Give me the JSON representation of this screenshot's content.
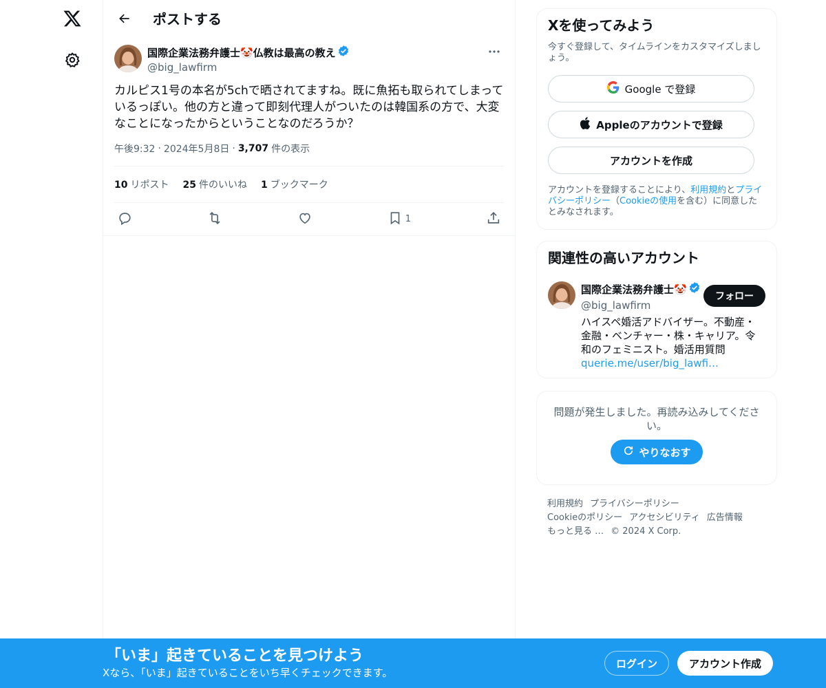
{
  "header": {
    "title": "ポストする"
  },
  "post": {
    "author_name": "国際企業法務弁護士🤡仏教は最高の教え",
    "author_handle": "@big_lawfirm",
    "text": "カルピス1号の本名が5chで晒されてますね。既に魚拓も取られてしまっているっぽい。他の方と違って即刻代理人がついたのは韓国系の方で、大変なことになったからということなのだろうか？",
    "time": "午後9:32",
    "date": "2024年5月8日",
    "views_count": "3,707",
    "views_label": "件の表示",
    "sep": "·",
    "stats": [
      {
        "count": "10",
        "label": "リポスト"
      },
      {
        "count": "25",
        "label": "件のいいね"
      },
      {
        "count": "1",
        "label": "ブックマーク"
      }
    ],
    "actions": {
      "reply": "",
      "repost": "",
      "like": "",
      "bookmark": "1",
      "share": ""
    }
  },
  "signup_card": {
    "title": "Xを使ってみよう",
    "subtitle": "今すぐ登録して、タイムラインをカスタマイズしましょう。",
    "google_label": "Google で登録",
    "apple_label": "Appleのアカウントで登録",
    "create_label": "アカウントを作成",
    "legal_1": "アカウントを登録することにより、",
    "legal_terms": "利用規約",
    "legal_and": "と",
    "legal_privacy": "プライバシーポリシー",
    "legal_2": "（",
    "legal_cookie": "Cookieの使用",
    "legal_3": "を含む）に同意したとみなされます。"
  },
  "related": {
    "title": "関連性の高いアカウント",
    "account": {
      "name": "国際企業法務弁護士🤡",
      "handle": "@big_lawfirm",
      "bio": "ハイスペ婚活アドバイザー。不動産・金融・ベンチャー・株・キャリア。令和のフェミニスト。婚活用質問",
      "link": "querie.me/user/big_lawfi…",
      "follow_label": "フォロー"
    }
  },
  "error_card": {
    "message": "問題が発生しました。再読み込みしてください。",
    "retry_label": "やりなおす"
  },
  "footer": {
    "terms": "利用規約",
    "privacy": "プライバシーポリシー",
    "cookie": "Cookieのポリシー",
    "accessibility": "アクセシビリティ",
    "ads": "広告情報",
    "more": "もっと見る …",
    "copyright": "© 2024 X Corp."
  },
  "bottombar": {
    "title": "「いま」起きていることを見つけよう",
    "subtitle": "Xなら、「いま」起きていることをいち早くチェックできます。",
    "login_label": "ログイン",
    "signup_label": "アカウント作成"
  },
  "colors": {
    "accent": "#1d9bf0",
    "text": "#0f1419",
    "muted": "#536471",
    "border": "#eff3f4"
  }
}
